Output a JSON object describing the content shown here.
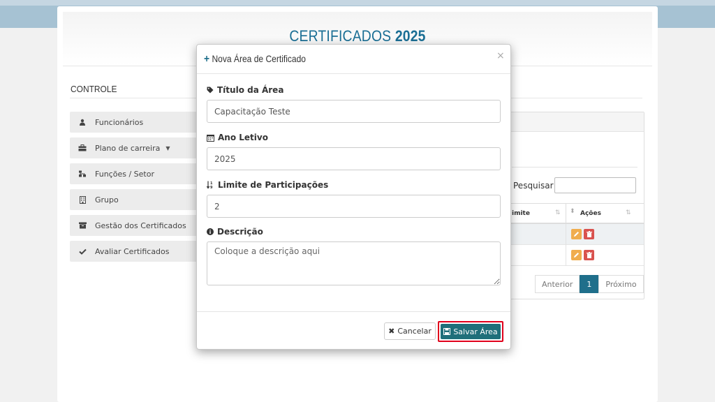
{
  "page": {
    "title_prefix": "CERTIFICADOS",
    "title_year": "2025"
  },
  "sidebar": {
    "heading": "CONTROLE",
    "items": [
      {
        "label": "Funcionários",
        "icon": "user-icon"
      },
      {
        "label": "Plano de carreira",
        "icon": "briefcase-icon",
        "has_dropdown": true
      },
      {
        "label": "Funções / Setor",
        "icon": "sitemap-icon"
      },
      {
        "label": "Grupo",
        "icon": "building-icon"
      },
      {
        "label": "Gestão dos Certificados",
        "icon": "archive-icon"
      },
      {
        "label": "Avaliar Certificados",
        "icon": "check-icon"
      }
    ]
  },
  "table": {
    "search_label": "Pesquisar",
    "search_value": "",
    "col_limite": "imite",
    "col_acoes": "Ações",
    "rows": [
      {
        "edit_icon": "pencil-icon",
        "delete_icon": "trash-icon"
      },
      {
        "edit_icon": "pencil-icon",
        "delete_icon": "trash-icon"
      }
    ],
    "pagination": {
      "prev": "Anterior",
      "current": "1",
      "next": "Próximo"
    }
  },
  "modal": {
    "title": "Nova Área de Certificado",
    "close": "×",
    "fields": {
      "titulo_label": "Título da Área",
      "titulo_value": "Capacitação Teste",
      "ano_label": "Ano Letivo",
      "ano_value": "2025",
      "limite_label": "Limite de Participações",
      "limite_value": "2",
      "descricao_label": "Descrição",
      "descricao_placeholder": "Coloque a descrição aqui"
    },
    "buttons": {
      "cancel": "Cancelar",
      "save": "Salvar Área"
    }
  },
  "colors": {
    "accent": "#1f6f8b",
    "title": "#1b6f95",
    "highlight_border": "#e0001b",
    "edit": "#f0ad4e",
    "delete": "#d9534f"
  }
}
